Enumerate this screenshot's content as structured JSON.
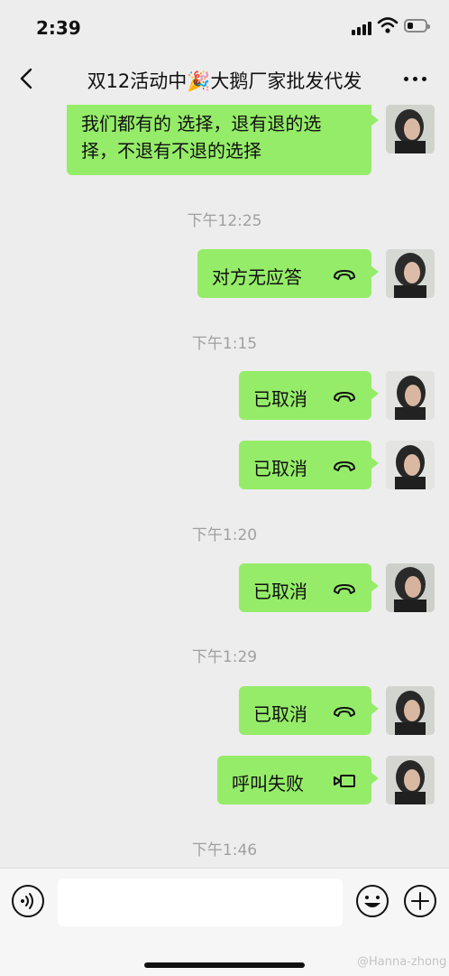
{
  "status": {
    "time": "2:39"
  },
  "header": {
    "title": "双12活动中🎉大鹅厂家批发代发"
  },
  "messages": [
    {
      "type": "text",
      "line1": "我们都有的 选择，退有退的选",
      "line2": "择，不退有不退的选择"
    },
    {
      "type": "time",
      "text": "下午12:25"
    },
    {
      "type": "call",
      "text": "对方无应答",
      "icon": "phone-hangup-icon"
    },
    {
      "type": "time",
      "text": "下午1:15"
    },
    {
      "type": "call",
      "text": "已取消",
      "icon": "phone-hangup-icon"
    },
    {
      "type": "call",
      "text": "已取消",
      "icon": "phone-hangup-icon"
    },
    {
      "type": "time",
      "text": "下午1:20"
    },
    {
      "type": "call",
      "text": "已取消",
      "icon": "phone-hangup-icon"
    },
    {
      "type": "time",
      "text": "下午1:29"
    },
    {
      "type": "call",
      "text": "已取消",
      "icon": "phone-hangup-icon"
    },
    {
      "type": "call",
      "text": "呼叫失败",
      "icon": "video-call-icon"
    },
    {
      "type": "time",
      "text": "下午1:46"
    }
  ],
  "input": {
    "placeholder": ""
  },
  "watermark": "@Hanna-zhong",
  "colors": {
    "bubble": "#95ec69",
    "background": "#ededed",
    "timestamp": "#a0a0a0"
  }
}
